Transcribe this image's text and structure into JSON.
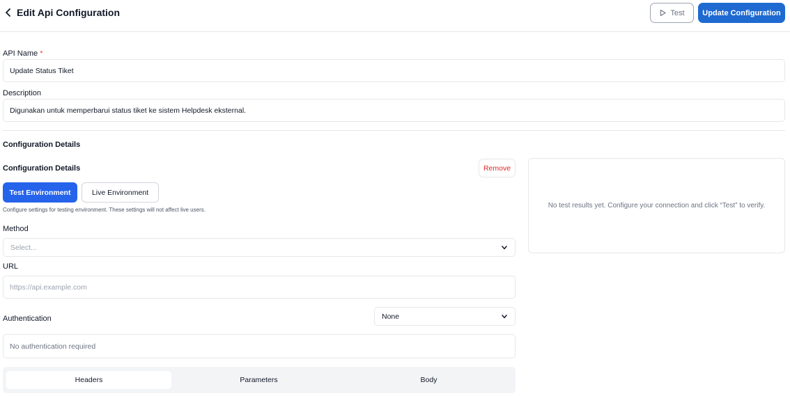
{
  "header": {
    "title": "Edit Api Configuration",
    "test_label": "Test",
    "update_label": "Update Configuration"
  },
  "api_name": {
    "label": "API Name",
    "required_mark": "*",
    "value": "Update Status Tiket"
  },
  "description": {
    "label": "Description",
    "value": "Digunakan untuk memperbarui status tiket ke sistem Helpdesk eksternal."
  },
  "config": {
    "section_title": "Configuration Details",
    "subsection_title": "Configuration Details",
    "remove_label": "Remove",
    "env_tabs": [
      "Test Environment",
      "Live Environment"
    ],
    "active_env": "Test Environment",
    "env_hint": "Configure settings for testing environment. These settings will not affect live users.",
    "method": {
      "label": "Method",
      "placeholder": "Select..."
    },
    "url": {
      "label": "URL",
      "placeholder": "https://api.example.com"
    },
    "authentication": {
      "label": "Authentication",
      "selected": "None",
      "info": "No authentication required"
    },
    "request_tabs": [
      "Headers",
      "Parameters",
      "Body"
    ],
    "active_request_tab": "Headers"
  },
  "results": {
    "empty_message": "No test results yet. Configure your connection and click “Test” to verify."
  },
  "colors": {
    "primary": "#1f6ad1",
    "env_active": "#2563eb",
    "remove": "#dc2626",
    "required": "#ef4444"
  },
  "icons": {
    "back": "chevron-left-icon",
    "test": "play-icon",
    "select": "chevron-down-icon"
  }
}
